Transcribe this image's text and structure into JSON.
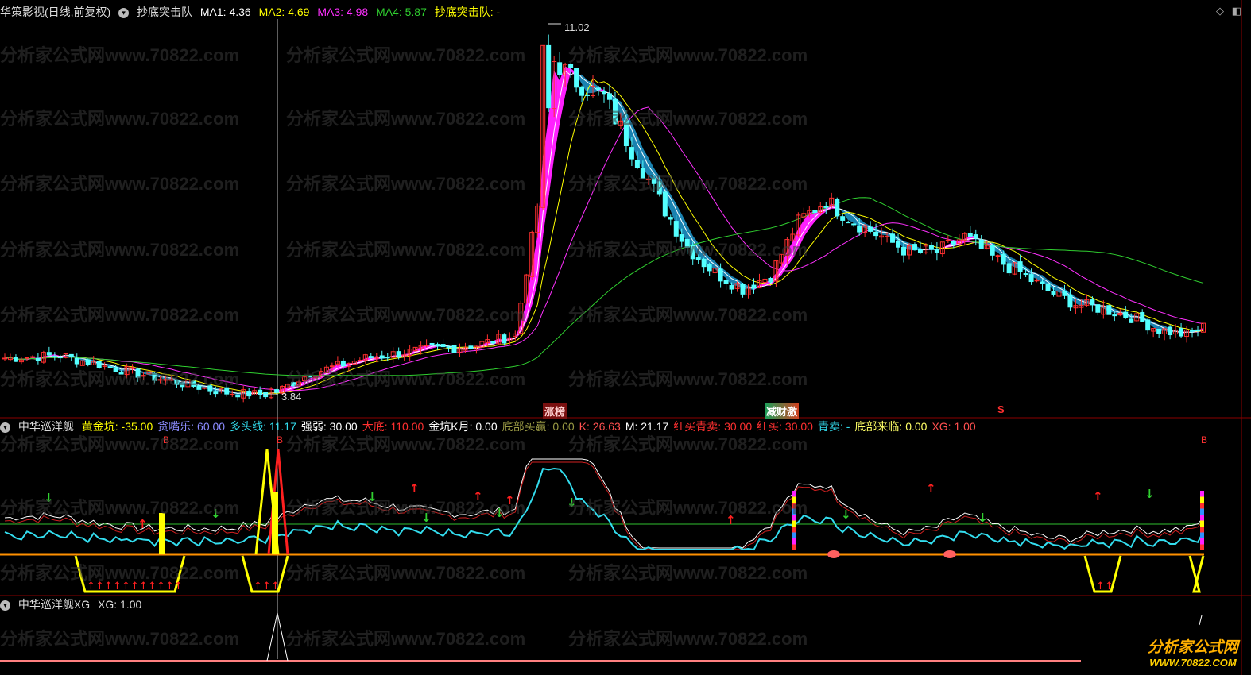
{
  "header_main": {
    "title": "华策影视(日线,前复权)",
    "indicator": "抄底突击队",
    "ma1": "MA1: 4.36",
    "ma2": "MA2: 4.69",
    "ma3": "MA3: 4.98",
    "ma4": "MA4: 5.87",
    "signal": "抄底突击队: -"
  },
  "header_sub1": {
    "title": "中华巡洋舰",
    "items": [
      {
        "label": "黄金坑: -35.00",
        "color": "#ffff00"
      },
      {
        "label": "贪嘴乐: 60.00",
        "color": "#8c8cff"
      },
      {
        "label": "多头线: 11.17",
        "color": "#33ddee"
      },
      {
        "label": "强弱: 30.00",
        "color": "#ffffff"
      },
      {
        "label": "大底: 110.00",
        "color": "#ff3030"
      },
      {
        "label": "金坑K月: 0.00",
        "color": "#ffffff"
      },
      {
        "label": "底部买赢: 0.00",
        "color": "#999944"
      },
      {
        "label": "K: 26.63",
        "color": "#ff5050"
      },
      {
        "label": "M: 21.17",
        "color": "#ffffff"
      },
      {
        "label": "红买青卖: 30.00",
        "color": "#ff3030"
      },
      {
        "label": "红买: 30.00",
        "color": "#ff3030"
      },
      {
        "label": "青卖: -",
        "color": "#33ddee"
      },
      {
        "label": "底部来临: 0.00",
        "color": "#ffff66"
      },
      {
        "label": "XG: 1.00",
        "color": "#ff5050"
      }
    ]
  },
  "header_sub2": {
    "title": "中华巡洋舰XG",
    "value": "XG: 1.00"
  },
  "annotations": {
    "high_label": "11.02",
    "low_label": "3.84",
    "tag_zhangbang": "涨榜",
    "tag_jiancai": "减财激",
    "tag_s": "S",
    "tag_b": "B"
  },
  "watermark": "分析家公式网www.70822.com",
  "logo": {
    "title": "分析家公式网",
    "url": "WWW.70822.COM"
  },
  "colors": {
    "up": "#ff3030",
    "down": "#54ffff",
    "ribbon_up": "#ff20ff",
    "ribbon_down": "#1a82b0",
    "ma1": "#ffffff",
    "ma2": "#ffff00",
    "ma3": "#ff30ff",
    "ma4": "#30d030"
  },
  "chart_data": {
    "type": "candlestick",
    "price_high": 11.02,
    "price_low": 3.84,
    "price_keypoints": [
      [
        0,
        4.55
      ],
      [
        10,
        4.6
      ],
      [
        20,
        4.35
      ],
      [
        30,
        4.1
      ],
      [
        40,
        3.88
      ],
      [
        48,
        3.84
      ],
      [
        55,
        4.25
      ],
      [
        65,
        4.55
      ],
      [
        75,
        4.7
      ],
      [
        85,
        4.8
      ],
      [
        92,
        5.0
      ],
      [
        96,
        7.5
      ],
      [
        99,
        10.3
      ],
      [
        103,
        9.9
      ],
      [
        108,
        9.6
      ],
      [
        113,
        8.6
      ],
      [
        118,
        7.6
      ],
      [
        123,
        6.7
      ],
      [
        128,
        6.2
      ],
      [
        133,
        5.9
      ],
      [
        138,
        6.15
      ],
      [
        143,
        7.2
      ],
      [
        148,
        7.6
      ],
      [
        153,
        7.2
      ],
      [
        158,
        6.9
      ],
      [
        163,
        6.6
      ],
      [
        168,
        6.6
      ],
      [
        173,
        6.9
      ],
      [
        178,
        6.5
      ],
      [
        183,
        6.2
      ],
      [
        188,
        5.85
      ],
      [
        193,
        5.6
      ],
      [
        198,
        5.5
      ],
      [
        203,
        5.35
      ],
      [
        208,
        5.1
      ],
      [
        213,
        5.0
      ],
      [
        216,
        5.15
      ]
    ],
    "ma_periods": [
      5,
      10,
      20,
      60
    ],
    "candle_count": 217
  }
}
